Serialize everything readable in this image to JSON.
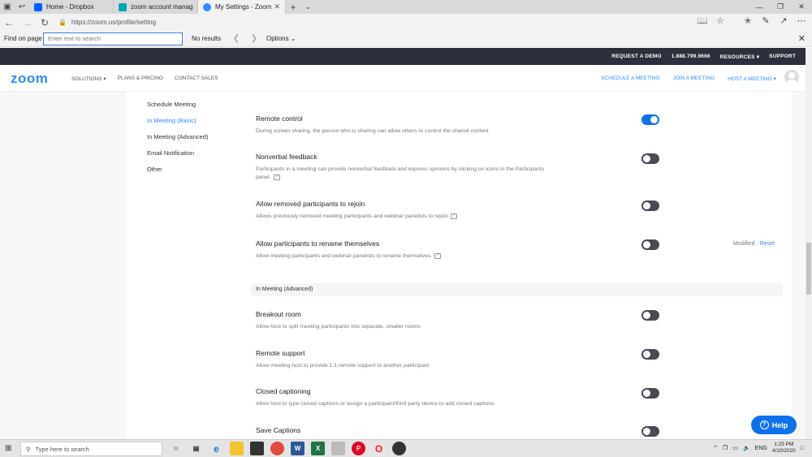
{
  "browser": {
    "tabs": [
      {
        "label": "Home - Dropbox",
        "color": "#0061fe",
        "active": false
      },
      {
        "label": "zoom account management",
        "color": "#00a4b4",
        "active": false
      },
      {
        "label": "My Settings - Zoom",
        "color": "#2d8cff",
        "active": true
      }
    ],
    "url": "https://zoom.us/profile/setting",
    "find": {
      "label": "Find on page",
      "placeholder": "Enter text to search",
      "result": "No results",
      "options": "Options"
    }
  },
  "topbar": {
    "items": [
      "REQUEST A DEMO",
      "1.888.799.9666",
      "RESOURCES ▾",
      "SUPPORT"
    ]
  },
  "header": {
    "logo": "zoom",
    "nav": [
      "SOLUTIONS ▾",
      "PLANS & PRICING",
      "CONTACT SALES"
    ],
    "right": [
      "SCHEDULE A MEETING",
      "JOIN A MEETING",
      "HOST A MEETING ▾"
    ]
  },
  "sidebar": {
    "items": [
      "Schedule Meeting",
      "In Meeting (Basic)",
      "In Meeting (Advanced)",
      "Email Notification",
      "Other"
    ],
    "active_index": 1
  },
  "settings": [
    {
      "title": "Remote control",
      "desc": "During screen sharing, the person who is sharing can allow others to control the shared content",
      "on": true
    },
    {
      "title": "Nonverbal feedback",
      "desc": "Participants in a meeting can provide nonverbal feedback and express opinions by clicking on icons in the Participants panel.",
      "on": false
    },
    {
      "title": "Allow removed participants to rejoin",
      "desc": "Allows previously removed meeting participants and webinar panelists to rejoin",
      "on": false
    },
    {
      "title": "Allow participants to rename themselves",
      "desc": "Allow meeting participants and webinar panelists to rename themselves.",
      "on": false,
      "modified": "Modified",
      "reset": "Reset"
    },
    {
      "title": "Breakout room",
      "desc": "Allow host to split meeting participants into separate, smaller rooms",
      "on": false
    },
    {
      "title": "Remote support",
      "desc": "Allow meeting host to provide 1:1 remote support to another participant",
      "on": false
    },
    {
      "title": "Closed captioning",
      "desc": "Allow host to type closed captions or assign a participant/third party device to add closed captions",
      "on": false
    },
    {
      "title": "Save Captions",
      "desc": "",
      "on": false
    }
  ],
  "section_advanced": "In Meeting (Advanced)",
  "help_label": "Help",
  "taskbar": {
    "search_placeholder": "Type here to search",
    "lang": "ENG",
    "time": "1:25 PM",
    "date": "4/10/2020"
  }
}
